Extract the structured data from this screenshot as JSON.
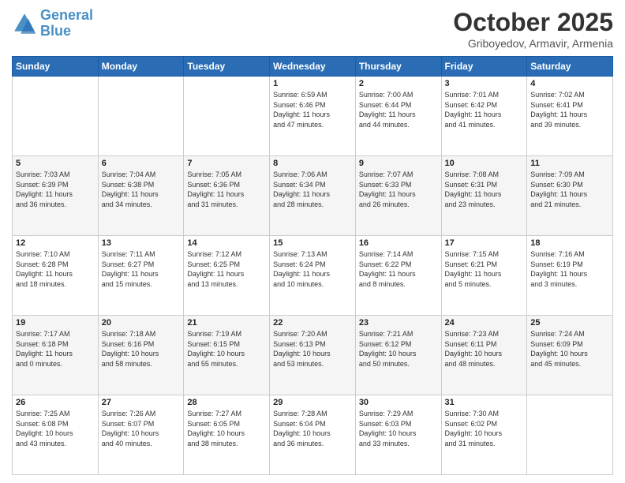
{
  "header": {
    "logo_line1": "General",
    "logo_line2": "Blue",
    "month_title": "October 2025",
    "location": "Griboyedov, Armavir, Armenia"
  },
  "days_of_week": [
    "Sunday",
    "Monday",
    "Tuesday",
    "Wednesday",
    "Thursday",
    "Friday",
    "Saturday"
  ],
  "weeks": [
    [
      {
        "day": "",
        "info": ""
      },
      {
        "day": "",
        "info": ""
      },
      {
        "day": "",
        "info": ""
      },
      {
        "day": "1",
        "info": "Sunrise: 6:59 AM\nSunset: 6:46 PM\nDaylight: 11 hours\nand 47 minutes."
      },
      {
        "day": "2",
        "info": "Sunrise: 7:00 AM\nSunset: 6:44 PM\nDaylight: 11 hours\nand 44 minutes."
      },
      {
        "day": "3",
        "info": "Sunrise: 7:01 AM\nSunset: 6:42 PM\nDaylight: 11 hours\nand 41 minutes."
      },
      {
        "day": "4",
        "info": "Sunrise: 7:02 AM\nSunset: 6:41 PM\nDaylight: 11 hours\nand 39 minutes."
      }
    ],
    [
      {
        "day": "5",
        "info": "Sunrise: 7:03 AM\nSunset: 6:39 PM\nDaylight: 11 hours\nand 36 minutes."
      },
      {
        "day": "6",
        "info": "Sunrise: 7:04 AM\nSunset: 6:38 PM\nDaylight: 11 hours\nand 34 minutes."
      },
      {
        "day": "7",
        "info": "Sunrise: 7:05 AM\nSunset: 6:36 PM\nDaylight: 11 hours\nand 31 minutes."
      },
      {
        "day": "8",
        "info": "Sunrise: 7:06 AM\nSunset: 6:34 PM\nDaylight: 11 hours\nand 28 minutes."
      },
      {
        "day": "9",
        "info": "Sunrise: 7:07 AM\nSunset: 6:33 PM\nDaylight: 11 hours\nand 26 minutes."
      },
      {
        "day": "10",
        "info": "Sunrise: 7:08 AM\nSunset: 6:31 PM\nDaylight: 11 hours\nand 23 minutes."
      },
      {
        "day": "11",
        "info": "Sunrise: 7:09 AM\nSunset: 6:30 PM\nDaylight: 11 hours\nand 21 minutes."
      }
    ],
    [
      {
        "day": "12",
        "info": "Sunrise: 7:10 AM\nSunset: 6:28 PM\nDaylight: 11 hours\nand 18 minutes."
      },
      {
        "day": "13",
        "info": "Sunrise: 7:11 AM\nSunset: 6:27 PM\nDaylight: 11 hours\nand 15 minutes."
      },
      {
        "day": "14",
        "info": "Sunrise: 7:12 AM\nSunset: 6:25 PM\nDaylight: 11 hours\nand 13 minutes."
      },
      {
        "day": "15",
        "info": "Sunrise: 7:13 AM\nSunset: 6:24 PM\nDaylight: 11 hours\nand 10 minutes."
      },
      {
        "day": "16",
        "info": "Sunrise: 7:14 AM\nSunset: 6:22 PM\nDaylight: 11 hours\nand 8 minutes."
      },
      {
        "day": "17",
        "info": "Sunrise: 7:15 AM\nSunset: 6:21 PM\nDaylight: 11 hours\nand 5 minutes."
      },
      {
        "day": "18",
        "info": "Sunrise: 7:16 AM\nSunset: 6:19 PM\nDaylight: 11 hours\nand 3 minutes."
      }
    ],
    [
      {
        "day": "19",
        "info": "Sunrise: 7:17 AM\nSunset: 6:18 PM\nDaylight: 11 hours\nand 0 minutes."
      },
      {
        "day": "20",
        "info": "Sunrise: 7:18 AM\nSunset: 6:16 PM\nDaylight: 10 hours\nand 58 minutes."
      },
      {
        "day": "21",
        "info": "Sunrise: 7:19 AM\nSunset: 6:15 PM\nDaylight: 10 hours\nand 55 minutes."
      },
      {
        "day": "22",
        "info": "Sunrise: 7:20 AM\nSunset: 6:13 PM\nDaylight: 10 hours\nand 53 minutes."
      },
      {
        "day": "23",
        "info": "Sunrise: 7:21 AM\nSunset: 6:12 PM\nDaylight: 10 hours\nand 50 minutes."
      },
      {
        "day": "24",
        "info": "Sunrise: 7:23 AM\nSunset: 6:11 PM\nDaylight: 10 hours\nand 48 minutes."
      },
      {
        "day": "25",
        "info": "Sunrise: 7:24 AM\nSunset: 6:09 PM\nDaylight: 10 hours\nand 45 minutes."
      }
    ],
    [
      {
        "day": "26",
        "info": "Sunrise: 7:25 AM\nSunset: 6:08 PM\nDaylight: 10 hours\nand 43 minutes."
      },
      {
        "day": "27",
        "info": "Sunrise: 7:26 AM\nSunset: 6:07 PM\nDaylight: 10 hours\nand 40 minutes."
      },
      {
        "day": "28",
        "info": "Sunrise: 7:27 AM\nSunset: 6:05 PM\nDaylight: 10 hours\nand 38 minutes."
      },
      {
        "day": "29",
        "info": "Sunrise: 7:28 AM\nSunset: 6:04 PM\nDaylight: 10 hours\nand 36 minutes."
      },
      {
        "day": "30",
        "info": "Sunrise: 7:29 AM\nSunset: 6:03 PM\nDaylight: 10 hours\nand 33 minutes."
      },
      {
        "day": "31",
        "info": "Sunrise: 7:30 AM\nSunset: 6:02 PM\nDaylight: 10 hours\nand 31 minutes."
      },
      {
        "day": "",
        "info": ""
      }
    ]
  ]
}
